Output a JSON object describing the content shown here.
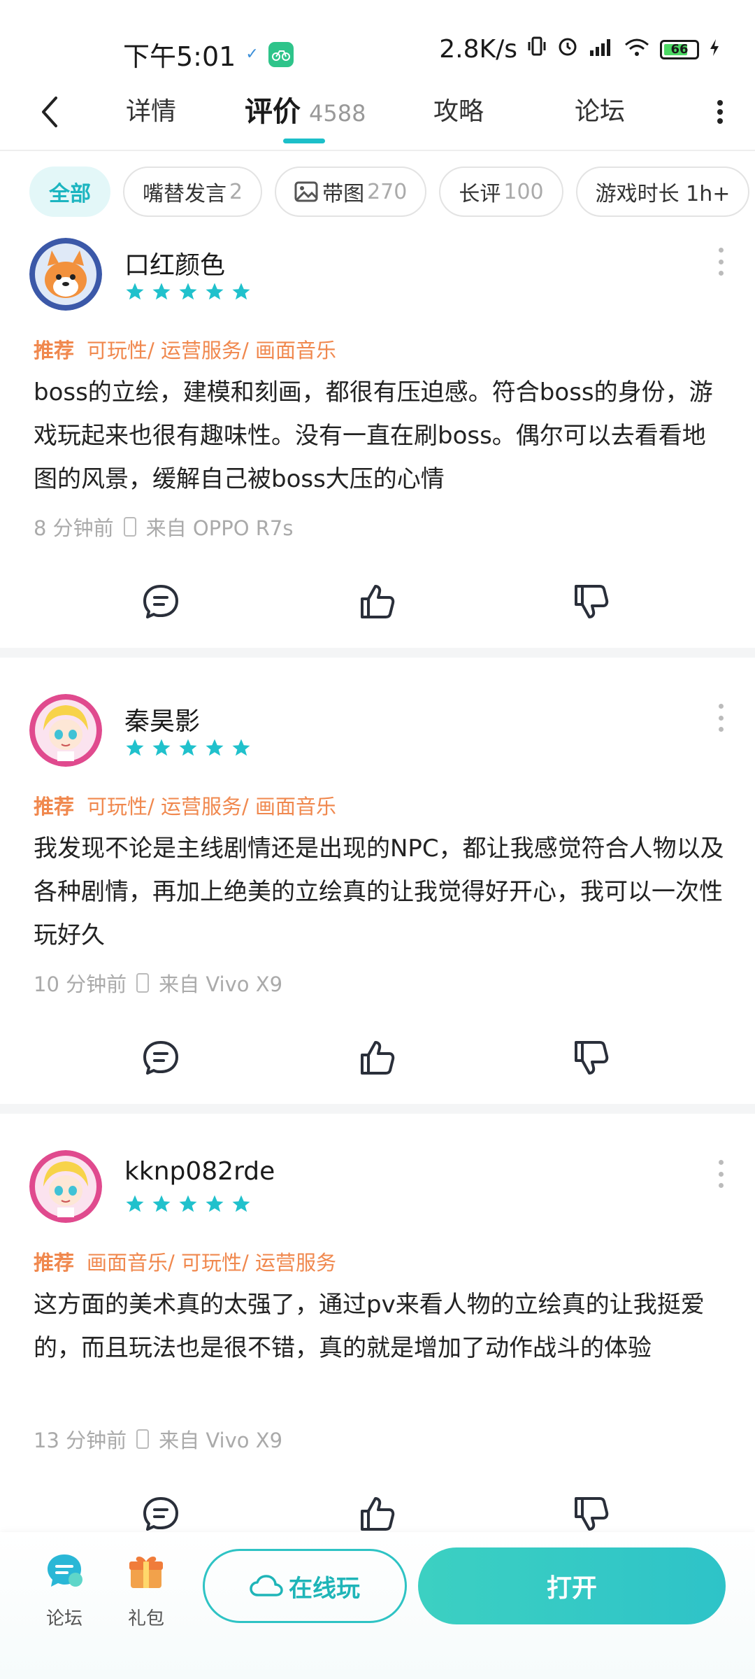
{
  "status_bar": {
    "time": "下午5:01",
    "network_speed": "2.8K/s",
    "battery": "66"
  },
  "nav": {
    "tabs": [
      {
        "label": "详情"
      },
      {
        "label": "评价",
        "count": "4588"
      },
      {
        "label": "攻略"
      },
      {
        "label": "论坛"
      }
    ]
  },
  "filters": [
    {
      "label": "全部",
      "count": ""
    },
    {
      "label": "嘴替发言",
      "count": "2"
    },
    {
      "label": "带图",
      "count": "270"
    },
    {
      "label": "长评",
      "count": "100"
    },
    {
      "label": "游戏时长 1h+",
      "count": ""
    }
  ],
  "reviews": [
    {
      "username": "口红颜色",
      "rating": 5,
      "recommend": "推荐",
      "tags": "可玩性/ 运营服务/ 画面音乐",
      "content": "boss的立绘，建模和刻画，都很有压迫感。符合boss的身份，游戏玩起来也很有趣味性。没有一直在刷boss。偶尔可以去看看地图的风景，缓解自己被boss大压的心情",
      "time": "8 分钟前",
      "device": "来自 OPPO R7s"
    },
    {
      "username": "秦昊影",
      "rating": 5,
      "recommend": "推荐",
      "tags": "可玩性/ 运营服务/ 画面音乐",
      "content": "我发现不论是主线剧情还是出现的NPC，都让我感觉符合人物以及各种剧情，再加上绝美的立绘真的让我觉得好开心，我可以一次性玩好久",
      "time": "10 分钟前",
      "device": "来自 Vivo X9"
    },
    {
      "username": "kknp082rde",
      "rating": 5,
      "recommend": "推荐",
      "tags": "画面音乐/ 可玩性/ 运营服务",
      "content": "这方面的美术真的太强了，通过pv来看人物的立绘真的让我挺爱的，而且玩法也是很不错，真的就是增加了动作战斗的体验",
      "time": "13 分钟前",
      "device": "来自 Vivo X9"
    }
  ],
  "bottom_bar": {
    "forum_label": "论坛",
    "gift_label": "礼包",
    "play_label": "在线玩",
    "open_label": "打开"
  },
  "colors": {
    "accent": "#1cbfc9",
    "star": "#20c1cc",
    "tag": "#f0884e"
  }
}
